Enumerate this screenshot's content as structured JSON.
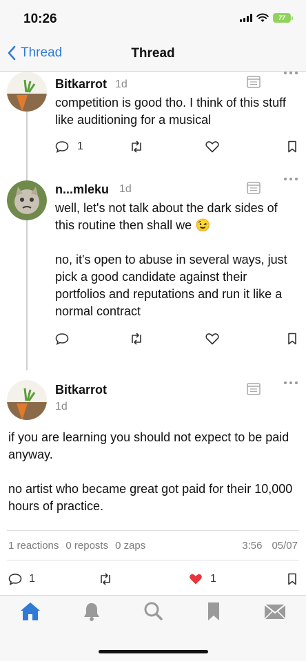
{
  "status_bar": {
    "time": "10:26",
    "battery": "77"
  },
  "nav": {
    "back_label": "Thread",
    "title": "Thread"
  },
  "posts": [
    {
      "author": "Bitkarrot",
      "age": "1d",
      "text": "competition is good tho. I think of this stuff like auditioning for a musical",
      "reply_count": "1"
    },
    {
      "author": "n...mleku",
      "age": "1d",
      "text": "well, let's not talk about the dark sides of this routine then shall we 😉\n\nno, it's open to abuse in several ways, just pick a good candidate against their portfolios and reputations and run it like a normal contract"
    }
  ],
  "main_post": {
    "author": "Bitkarrot",
    "age": "1d",
    "text": "if you are learning you should not expect to be paid anyway.\n\nno artist who became great got paid for their 10,000 hours of practice.",
    "stats": {
      "reactions": "1 reactions",
      "reposts": "0 reposts",
      "zaps": "0 zaps"
    },
    "time": "3:56",
    "date": "05/07",
    "reply_count": "1",
    "like_count": "1"
  },
  "colors": {
    "accent": "#2f7bd6",
    "heart": "#e8343c",
    "battery": "#8fd35a"
  },
  "tabs": [
    "home-icon",
    "bell-icon",
    "search-icon",
    "bookmark-icon",
    "mail-icon"
  ]
}
